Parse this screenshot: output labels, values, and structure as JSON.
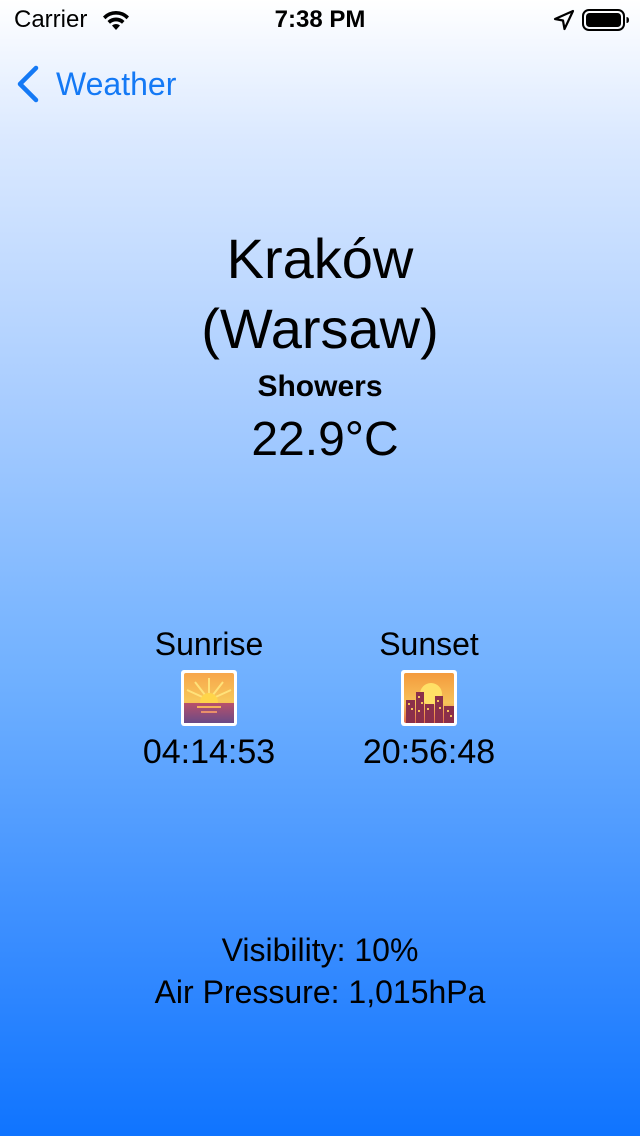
{
  "status_bar": {
    "carrier": "Carrier",
    "time": "7:38 PM",
    "icons": [
      "wifi-icon",
      "location-icon",
      "battery-icon"
    ]
  },
  "nav": {
    "back_label": "Weather",
    "back_icon": "chevron-left-icon",
    "accent_color": "#1479f5"
  },
  "weather": {
    "city_line1": "Kraków",
    "city_line2": "(Warsaw)",
    "condition": "Showers",
    "temperature": "22.9°C"
  },
  "sun": {
    "sunrise_label": "Sunrise",
    "sunrise_icon": "sunrise-icon",
    "sunrise_time": "04:14:53",
    "sunset_label": "Sunset",
    "sunset_icon": "sunset-icon",
    "sunset_time": "20:56:48"
  },
  "details": {
    "visibility": "Visibility: 10%",
    "pressure": "Air Pressure: 1,015hPa"
  }
}
